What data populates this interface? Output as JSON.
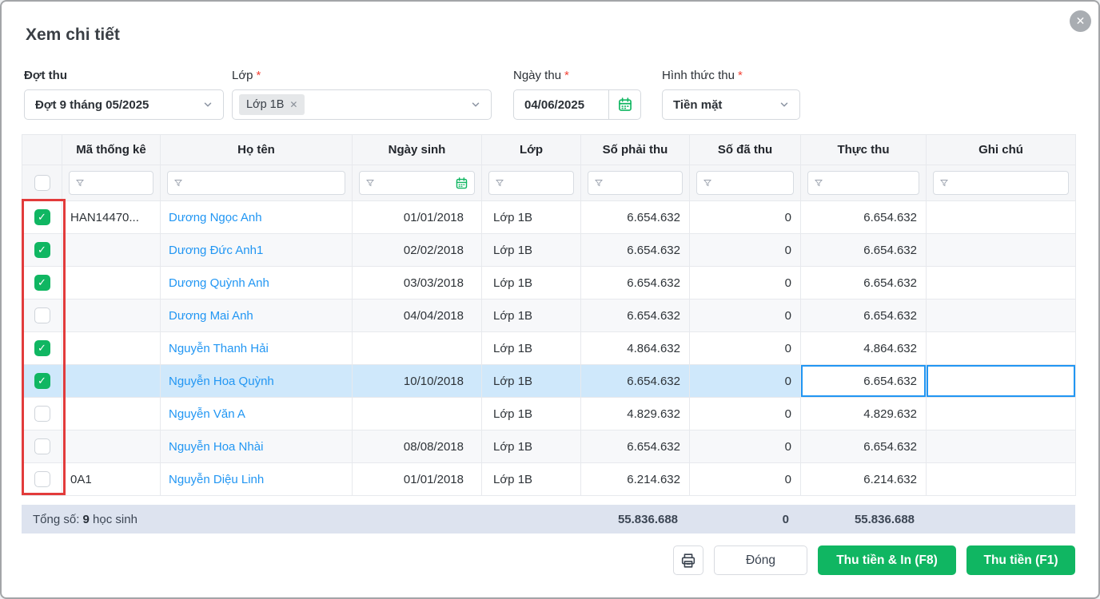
{
  "dialog": {
    "title": "Xem chi tiết"
  },
  "filters": {
    "dot_thu": {
      "label": "Đợt thu",
      "value": "Đợt 9 tháng 05/2025"
    },
    "lop": {
      "label": "Lớp",
      "required": "*",
      "tag": "Lớp 1B",
      "tag_remove": "✕"
    },
    "ngay_thu": {
      "label": "Ngày thu",
      "required": "*",
      "value": "04/06/2025"
    },
    "hinh_thuc": {
      "label": "Hình thức thu",
      "required": "*",
      "value": "Tiền mặt"
    }
  },
  "table": {
    "columns": [
      "Mã thống kê",
      "Họ tên",
      "Ngày sinh",
      "Lớp",
      "Số phải thu",
      "Số đã thu",
      "Thực thu",
      "Ghi chú"
    ],
    "rows": [
      {
        "checked": true,
        "code": "HAN14470...",
        "name": "Dương Ngọc Anh",
        "dob": "01/01/2018",
        "class": "Lớp 1B",
        "due": "6.654.632",
        "paid": "0",
        "actual": "6.654.632",
        "note": ""
      },
      {
        "checked": true,
        "code": "",
        "name": "Dương Đức Anh1",
        "dob": "02/02/2018",
        "class": "Lớp 1B",
        "due": "6.654.632",
        "paid": "0",
        "actual": "6.654.632",
        "note": ""
      },
      {
        "checked": true,
        "code": "",
        "name": "Dương Quỳnh Anh",
        "dob": "03/03/2018",
        "class": "Lớp 1B",
        "due": "6.654.632",
        "paid": "0",
        "actual": "6.654.632",
        "note": ""
      },
      {
        "checked": false,
        "code": "",
        "name": "Dương Mai Anh",
        "dob": "04/04/2018",
        "class": "Lớp 1B",
        "due": "6.654.632",
        "paid": "0",
        "actual": "6.654.632",
        "note": ""
      },
      {
        "checked": true,
        "code": "",
        "name": "Nguyễn Thanh Hải",
        "dob": "",
        "class": "Lớp 1B",
        "due": "4.864.632",
        "paid": "0",
        "actual": "4.864.632",
        "note": ""
      },
      {
        "checked": true,
        "code": "",
        "name": "Nguyễn Hoa Quỳnh",
        "dob": "10/10/2018",
        "class": "Lớp 1B",
        "due": "6.654.632",
        "paid": "0",
        "actual": "6.654.632",
        "note": "",
        "highlighted": true
      },
      {
        "checked": false,
        "code": "",
        "name": "Nguyễn Văn A",
        "dob": "",
        "class": "Lớp 1B",
        "due": "4.829.632",
        "paid": "0",
        "actual": "4.829.632",
        "note": ""
      },
      {
        "checked": false,
        "code": "",
        "name": "Nguyễn Hoa Nhài",
        "dob": "08/08/2018",
        "class": "Lớp 1B",
        "due": "6.654.632",
        "paid": "0",
        "actual": "6.654.632",
        "note": ""
      },
      {
        "checked": false,
        "code": "0A1",
        "name": "Nguyễn Diệu Linh",
        "dob": "01/01/2018",
        "class": "Lớp 1B",
        "due": "6.214.632",
        "paid": "0",
        "actual": "6.214.632",
        "note": ""
      }
    ],
    "footer": {
      "prefix": "Tổng số: ",
      "count": "9",
      "suffix": " học sinh",
      "total_due": "55.836.688",
      "total_paid": "0",
      "total_actual": "55.836.688"
    }
  },
  "buttons": {
    "close_dialog": "Đóng",
    "collect_print": "Thu tiền & In (F8)",
    "collect": "Thu tiền (F1)"
  },
  "icons": {
    "close": "✕",
    "check": "✓"
  },
  "colors": {
    "accent_green": "#10b662",
    "link_blue": "#2196f3",
    "highlight_row": "#cfe8fb",
    "annotation_red": "#e23b3b",
    "summary_band": "#dde3ef"
  }
}
